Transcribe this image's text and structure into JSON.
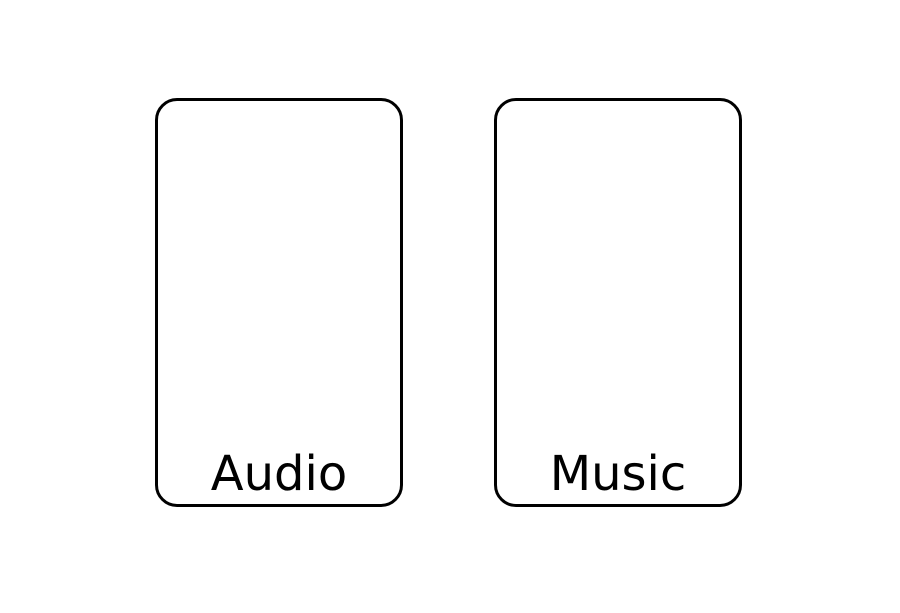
{
  "cards": [
    {
      "label": "Audio"
    },
    {
      "label": "Music"
    }
  ],
  "colors": {
    "background": "#ffffff",
    "stroke": "#000000",
    "text": "#000000"
  }
}
